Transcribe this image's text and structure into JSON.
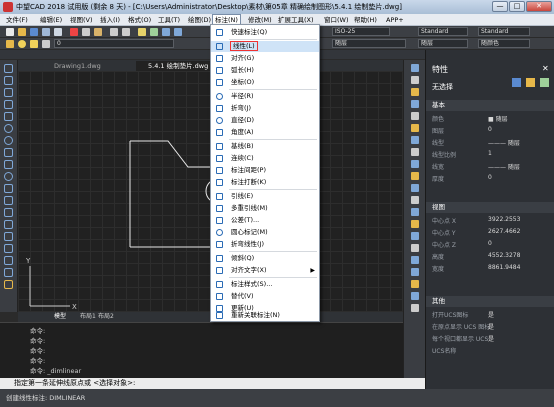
{
  "window": {
    "title": "中望CAD 2018 试用版 (剩余 8 天) - [C:\\Users\\Administrator\\Desktop\\素材\\第05章 精确绘制图形\\5.4.1 绘制垫片.dwg]",
    "minimize": "—",
    "maximize": "□",
    "close": "✕"
  },
  "menu": [
    "文件(F)",
    "编辑(E)",
    "视图(V)",
    "插入(I)",
    "格式(O)",
    "工具(T)",
    "绘图(D)",
    "标注(N)",
    "修改(M)",
    "扩展工具(X)",
    "窗口(W)",
    "帮助(H)",
    "APP+"
  ],
  "toolbar": {
    "layer_combo": "ISO-25",
    "textstyle_combo": "Standard",
    "dimstyle_combo": "Standard",
    "layer_name": "0",
    "color": "随层",
    "linetype": "随层",
    "lineweight": "随层",
    "plotstyle": "随颜色"
  },
  "doc_tabs": [
    "Drawing1.dwg",
    "5.4.1 绘制垫片.dwg"
  ],
  "dim_menu": {
    "items": [
      {
        "label": "快速标注(Q)",
        "icon": "quick-dim-icon"
      },
      {
        "label": "线性(L)",
        "icon": "linear-dim-icon",
        "highlight": true
      },
      {
        "label": "对齐(G)",
        "icon": "aligned-dim-icon"
      },
      {
        "label": "弧长(H)",
        "icon": "arc-length-icon"
      },
      {
        "label": "坐标(O)",
        "icon": "ordinate-icon"
      },
      {
        "label": "半径(R)",
        "icon": "radius-icon"
      },
      {
        "label": "折弯(J)",
        "icon": "jog-icon"
      },
      {
        "label": "直径(D)",
        "icon": "diameter-icon"
      },
      {
        "label": "角度(A)",
        "icon": "angle-icon"
      },
      {
        "label": "基线(B)",
        "icon": "baseline-icon"
      },
      {
        "label": "连续(C)",
        "icon": "continue-icon"
      },
      {
        "label": "标注间距(P)",
        "icon": "space-icon"
      },
      {
        "label": "标注打断(K)",
        "icon": "break-icon"
      },
      {
        "label": "引线(E)",
        "icon": "leader-icon"
      },
      {
        "label": "多重引线(M)",
        "icon": "mleader-icon"
      },
      {
        "label": "公差(T)...",
        "icon": "tolerance-icon"
      },
      {
        "label": "圆心标记(M)",
        "icon": "center-mark-icon"
      },
      {
        "label": "折弯线性(J)",
        "icon": "jogged-linear-icon"
      },
      {
        "label": "倾斜(Q)",
        "icon": "oblique-icon"
      },
      {
        "label": "对齐文字(X)",
        "icon": "align-text-icon",
        "submenu": true
      },
      {
        "label": "标注样式(S)...",
        "icon": "dimstyle-icon"
      },
      {
        "label": "替代(V)",
        "icon": "override-icon"
      },
      {
        "label": "更新(U)",
        "icon": "update-icon"
      },
      {
        "label": "重新关联标注(N)",
        "icon": "reassociate-icon"
      }
    ]
  },
  "layout_tabs": [
    "模型",
    "布局1",
    "布局2"
  ],
  "command": {
    "lines": [
      "命令:",
      "命令:",
      "命令:",
      "命令:",
      "命令: _dimlinear"
    ],
    "prompt": "指定第一条延伸线原点或 <选择对象>:"
  },
  "status": "创建线性标注: DIMLINEAR",
  "props": {
    "title": "特性",
    "selection": "无选择",
    "basic_header": "基本",
    "basic": [
      [
        "颜色",
        "■ 随层"
      ],
      [
        "图层",
        "0"
      ],
      [
        "线型",
        "——— 随层"
      ],
      [
        "线型比例",
        "1"
      ],
      [
        "线宽",
        "——— 随层"
      ],
      [
        "厚度",
        "0"
      ]
    ],
    "view_header": "视图",
    "view": [
      [
        "中心点 X",
        "3922.2553"
      ],
      [
        "中心点 Y",
        "2627.4662"
      ],
      [
        "中心点 Z",
        "0"
      ],
      [
        "高度",
        "4552.3278"
      ],
      [
        "宽度",
        "8861.9484"
      ]
    ],
    "misc_header": "其他",
    "misc": [
      [
        "打开UCS图标",
        "是"
      ],
      [
        "在原点显示 UCS 图标",
        "是"
      ],
      [
        "每个视口都显示 UCS",
        "是"
      ],
      [
        "UCS名称",
        ""
      ]
    ]
  },
  "colors": {
    "accent": "#2a6bb5",
    "highlight_outline": "#e33",
    "canvas": "#212121"
  }
}
